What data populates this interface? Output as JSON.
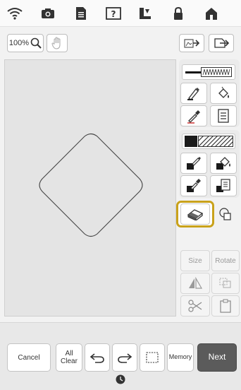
{
  "topbar": {
    "icons": [
      "wifi-icon",
      "camera-icon",
      "document-icon",
      "help-icon",
      "sewing-machine-icon",
      "lock-icon",
      "home-icon"
    ]
  },
  "toolbar": {
    "zoom_label": "100%",
    "icons": [
      "zoom-icon",
      "hand-pan-icon",
      "import-icon",
      "export-icon"
    ]
  },
  "canvas": {
    "shape": "rounded-diamond"
  },
  "tools": {
    "size_label": "Size",
    "rotate_label": "Rotate",
    "selected_tool": "eraser",
    "highlight_color": "#c9a21b"
  },
  "bottom": {
    "cancel_label": "Cancel",
    "all_clear_line1": "All",
    "all_clear_line2": "Clear",
    "memory_label": "Memory",
    "next_label": "Next"
  }
}
